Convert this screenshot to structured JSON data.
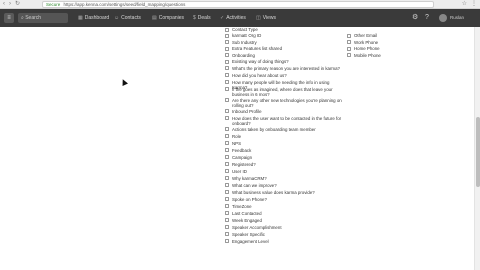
{
  "browser": {
    "secure_label": "Secure",
    "url": "https://app.kenna.com/settings/seed/field_mapping/questions"
  },
  "app": {
    "search_placeholder": "Search",
    "nav": [
      {
        "label": "Dashboard",
        "icon": "dashboard-icon"
      },
      {
        "label": "Contacts",
        "icon": "contacts-icon"
      },
      {
        "label": "Companies",
        "icon": "companies-icon"
      },
      {
        "label": "Deals",
        "icon": "deals-icon"
      },
      {
        "label": "Activities",
        "icon": "activities-icon"
      },
      {
        "label": "Views",
        "icon": "views-icon"
      }
    ],
    "user": "Ruslan"
  },
  "fields_col1": [
    "Contact Type",
    "karmaE Org ID",
    "Sub Industry",
    "Extra Features list shared",
    "Onboarding",
    "Existing way of doing things?",
    "What's the primary reason you are interested in karma?",
    "How did you hear about us?",
    "How many people will be needing the info in using Karma?",
    "If the goes as imagined, where does that leave your business in 6 mos?",
    "Are there any other new technologies you're planning on rolling out?",
    "Inbound Profile",
    "How does the user want to be contacted in the future for onboard?",
    "Actions taken by onboarding team member",
    "Role",
    "NPS",
    "Feedback",
    "Campaign",
    "Registered?",
    "User ID",
    "Why karmaCRM?",
    "What can we improve?",
    "What business value does karma provide?",
    "Spoke on Phone?",
    "TimeZone",
    "Last Contacted",
    "Week Engaged",
    "Speaker Accomplishment",
    "Speaker Specific",
    "Engagement Level"
  ],
  "fields_col2": [
    "",
    "Other Email",
    "Work Phone",
    "Home Phone",
    "Mobile Phone"
  ]
}
